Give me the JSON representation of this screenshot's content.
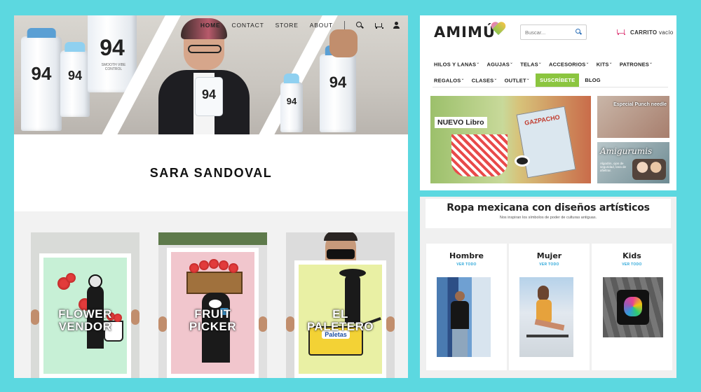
{
  "sara": {
    "nav": {
      "home": "HOME",
      "contact": "CONTACT",
      "store": "STORE",
      "about": "ABOUT"
    },
    "cans": [
      "94",
      "94",
      "94",
      "94",
      "94",
      "94"
    ],
    "can_text": "SMOOTH VIBE CONTROL",
    "artist_name": "SARA SANDOVAL",
    "prints": [
      {
        "title_line1": "FLOWER",
        "title_line2": "VENDOR",
        "bg": "#c7f0d6"
      },
      {
        "title_line1": "FRUIT",
        "title_line2": "PICKER",
        "bg": "#f1c6cd"
      },
      {
        "title_line1": "EL",
        "title_line2": "PALETERO",
        "bg": "#e9f0a4"
      }
    ],
    "cart_sign": "Paletas"
  },
  "amimu": {
    "logo": "AMIMÚ",
    "search_placeholder": "Buscar...",
    "cart_label": "CARRITO",
    "cart_state": "vacío",
    "menu_row1": [
      "HILOS Y LANAS",
      "AGUJAS",
      "TELAS",
      "ACCESORIOS",
      "KITS",
      "PATRONES"
    ],
    "menu_row2": [
      "REGALOS",
      "CLASES",
      "OUTLET"
    ],
    "cta": "SUSCRÍBETE",
    "blog": "BLOG",
    "banner_main": "NUEVO Libro",
    "book_title": "GAZPACHO",
    "side1_label": "Especial Punch needle",
    "side2_label": "Amigurumis",
    "side2_small": "Algodón, ojos de seguridad, lana de afieltrar.",
    "accent": "#8bc53f"
  },
  "ropa": {
    "title": "Ropa mexicana con diseños artísticos",
    "subtitle": "Nos inspiran los símbolos de poder de culturas antiguas.",
    "categories": [
      {
        "name": "Hombre",
        "link": "VER TODO"
      },
      {
        "name": "Mujer",
        "link": "VER TODO"
      },
      {
        "name": "Kids",
        "link": "VER TODO"
      }
    ],
    "link_color": "#2aa6d9"
  }
}
